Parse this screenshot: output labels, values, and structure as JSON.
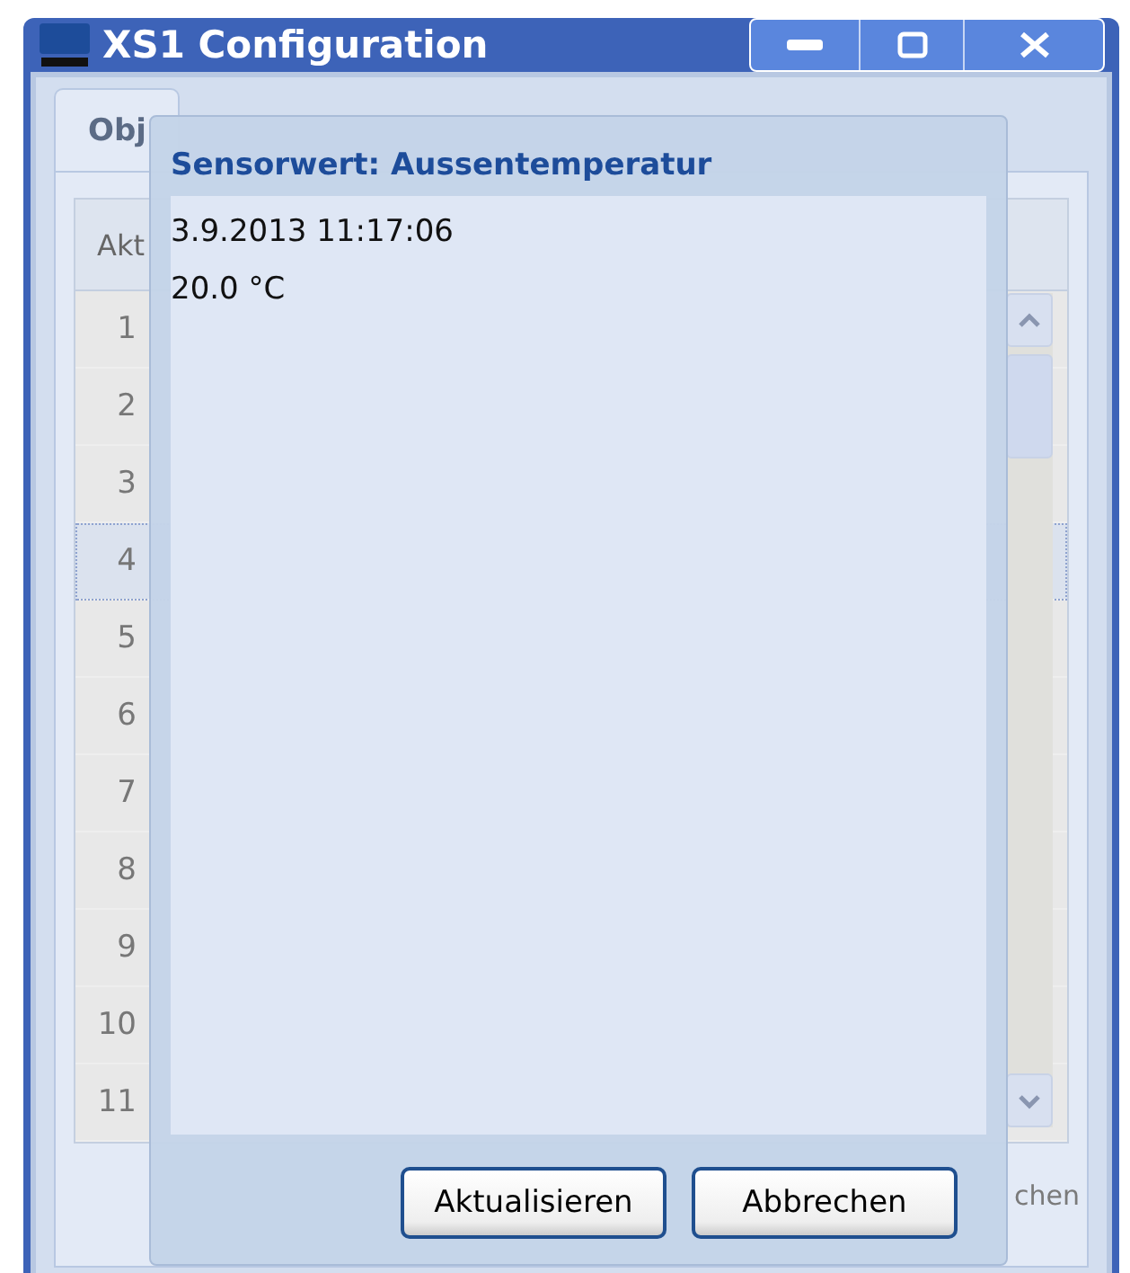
{
  "window": {
    "title": "XS1 Configuration"
  },
  "tabs": [
    {
      "label": "Obj",
      "selected": true
    }
  ],
  "table": {
    "header": "Akt",
    "rows": [
      {
        "number": "1",
        "selected": false
      },
      {
        "number": "2",
        "selected": false
      },
      {
        "number": "3",
        "selected": false
      },
      {
        "number": "4",
        "selected": true
      },
      {
        "number": "5",
        "selected": false
      },
      {
        "number": "6",
        "selected": false
      },
      {
        "number": "7",
        "selected": false
      },
      {
        "number": "8",
        "selected": false
      },
      {
        "number": "9",
        "selected": false
      },
      {
        "number": "10",
        "selected": false
      },
      {
        "number": "11",
        "selected": false
      }
    ]
  },
  "footer_button": "chen",
  "dialog": {
    "title": "Sensorwert: Aussentemperatur",
    "lines": [
      "3.9.2013 11:17:06",
      "20.0 °C"
    ],
    "buttons": [
      "Aktualisieren",
      "Abbrechen"
    ]
  }
}
